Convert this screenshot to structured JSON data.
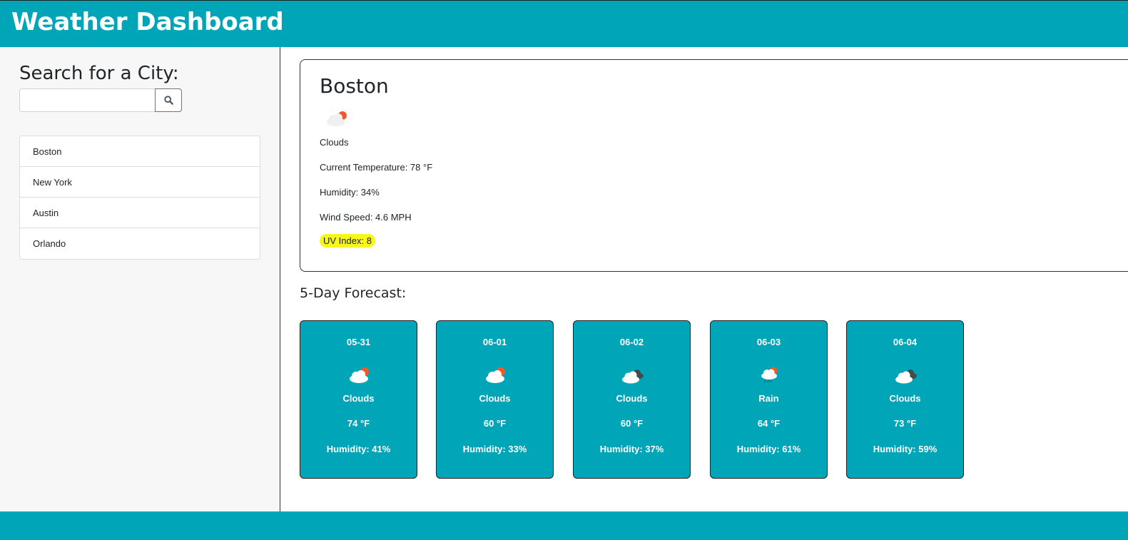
{
  "header": {
    "title": "Weather Dashboard"
  },
  "sidebar": {
    "search_heading": "Search for a City:",
    "search_value": "",
    "search_placeholder": "",
    "search_button_icon": "search-icon",
    "cities": [
      "Boston",
      "New York",
      "Austin",
      "Orlando"
    ]
  },
  "current": {
    "city": "Boston",
    "icon": "clouds-sun-icon",
    "condition": "Clouds",
    "temperature": "Current Temperature: 78 °F",
    "humidity": "Humidity: 34%",
    "wind": "Wind Speed: 4.6 MPH",
    "uv": "UV Index: 8"
  },
  "forecast": {
    "title": "5-Day Forecast:",
    "days": [
      {
        "date": "05-31",
        "icon": "clouds-sun-icon",
        "condition": "Clouds",
        "temp": "74 °F",
        "humidity": "Humidity: 41%"
      },
      {
        "date": "06-01",
        "icon": "clouds-sun-icon",
        "condition": "Clouds",
        "temp": "60 °F",
        "humidity": "Humidity: 33%"
      },
      {
        "date": "06-02",
        "icon": "broken-clouds-icon",
        "condition": "Clouds",
        "temp": "60 °F",
        "humidity": "Humidity: 37%"
      },
      {
        "date": "06-03",
        "icon": "rain-sun-icon",
        "condition": "Rain",
        "temp": "64 °F",
        "humidity": "Humidity: 61%"
      },
      {
        "date": "06-04",
        "icon": "broken-clouds-icon",
        "condition": "Clouds",
        "temp": "73 °F",
        "humidity": "Humidity: 59%"
      }
    ]
  },
  "colors": {
    "accent": "#00a5b8",
    "uv_highlight": "#f7f71e",
    "sun": "#f05a28"
  }
}
